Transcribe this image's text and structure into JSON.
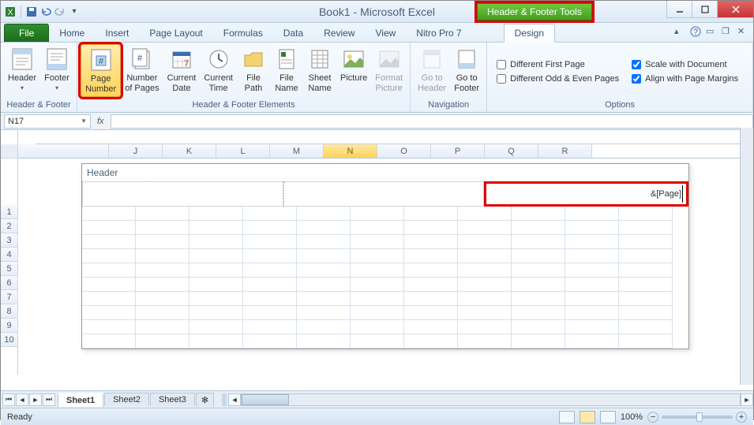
{
  "title": "Book1 - Microsoft Excel",
  "contextual_tab": "Header & Footer Tools",
  "tabs": {
    "file": "File",
    "home": "Home",
    "insert": "Insert",
    "page_layout": "Page Layout",
    "formulas": "Formulas",
    "data": "Data",
    "review": "Review",
    "view": "View",
    "nitro": "Nitro Pro 7",
    "design": "Design"
  },
  "ribbon": {
    "group1": {
      "header": "Header",
      "footer": "Footer",
      "label": "Header & Footer"
    },
    "group2": {
      "page_number": "Page\nNumber",
      "number_of_pages": "Number\nof Pages",
      "current_date": "Current\nDate",
      "current_time": "Current\nTime",
      "file_path": "File\nPath",
      "file_name": "File\nName",
      "sheet_name": "Sheet\nName",
      "picture": "Picture",
      "format_picture": "Format\nPicture",
      "label": "Header & Footer Elements"
    },
    "group3": {
      "goto_header": "Go to\nHeader",
      "goto_footer": "Go to\nFooter",
      "label": "Navigation"
    },
    "group4": {
      "dfp": "Different First Page",
      "doe": "Different Odd & Even Pages",
      "swd": "Scale with Document",
      "apm": "Align with Page Margins",
      "label": "Options"
    }
  },
  "name_box": "N17",
  "columns": [
    "J",
    "K",
    "L",
    "M",
    "N",
    "O",
    "P",
    "Q",
    "R"
  ],
  "rows": [
    "1",
    "2",
    "3",
    "4",
    "5",
    "6",
    "7",
    "8",
    "9",
    "10"
  ],
  "header_label": "Header",
  "header_code": "&[Page]",
  "sheets": {
    "s1": "Sheet1",
    "s2": "Sheet2",
    "s3": "Sheet3"
  },
  "status": "Ready",
  "zoom": "100%"
}
